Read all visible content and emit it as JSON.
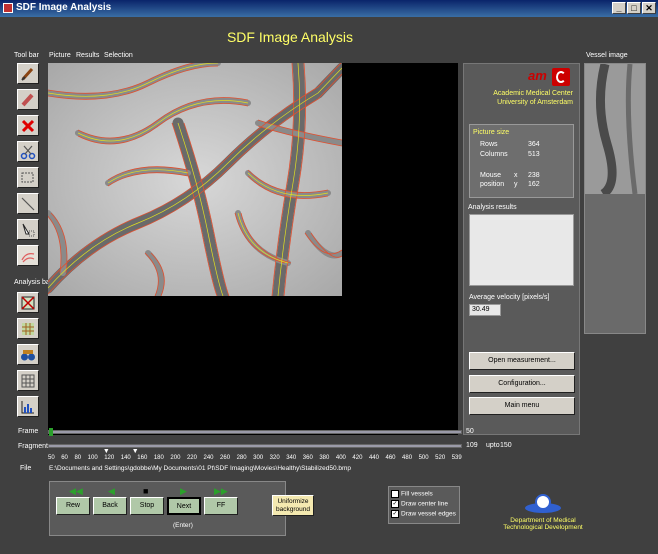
{
  "window": {
    "title": "SDF Image Analysis",
    "minimize": "_",
    "maximize": "□",
    "close": "✕"
  },
  "app_title": "SDF Image Analysis",
  "menu": {
    "toolbar": "Tool bar",
    "picture": "Picture",
    "results": "Results",
    "selection": "Selection"
  },
  "analysis_bar_label": "Analysis bar",
  "tools": [
    "brush-icon",
    "eraser-icon",
    "delete-icon",
    "scissors-icon",
    "select-rect-icon",
    "line-icon",
    "fill-select-icon",
    "vessel-draw-icon"
  ],
  "analysis_tools": [
    "crosshair-icon",
    "mesh-icon",
    "binoculars-icon",
    "grid-icon",
    "histogram-icon"
  ],
  "logo": {
    "mark": "am",
    "line1": "Academic Medical Center",
    "line2": "University of Amsterdam"
  },
  "picture_size": {
    "heading": "Picture size",
    "rows_label": "Rows",
    "rows": "364",
    "columns_label": "Columns",
    "columns": "513",
    "mouse_label1": "Mouse",
    "mouse_label2": "position",
    "x_label": "x",
    "x": "238",
    "y_label": "y",
    "y": "162"
  },
  "analysis_results_label": "Analysis results",
  "velocity": {
    "label": "Average velocity [pixels/s]",
    "value": "30.49"
  },
  "buttons": {
    "open": "Open measurement...",
    "config": "Configuration...",
    "main": "Main menu"
  },
  "vessel_image_label": "Vessel image",
  "frame": {
    "label": "Frame",
    "value": "50",
    "position": 0.0
  },
  "fragment": {
    "label": "Fragment",
    "value": "109",
    "upto_label": "upto",
    "upto": "150",
    "start": 0.13,
    "end": 0.2
  },
  "ticks": [
    "50",
    "60",
    "80",
    "100",
    "120",
    "140",
    "160",
    "180",
    "200",
    "220",
    "240",
    "260",
    "280",
    "300",
    "320",
    "340",
    "360",
    "380",
    "400",
    "420",
    "440",
    "460",
    "480",
    "500",
    "520",
    "539"
  ],
  "file": {
    "label": "File",
    "path": "E:\\Documents and Settings\\gdobbe\\My Documents\\01 Pt\\SDF Imaging\\Movies\\Healthy\\Stabilized50.bmp"
  },
  "controls": {
    "rew": "Rew",
    "back": "Back",
    "stop": "Stop",
    "next": "Next",
    "ff": "FF",
    "enter": "(Enter)",
    "uniformize1": "Uniformize",
    "uniformize2": "background"
  },
  "checks": {
    "fill": "Fill vessels",
    "center": "Draw center line",
    "edges": "Draw vessel edges",
    "fill_checked": false,
    "center_checked": true,
    "edges_checked": true
  },
  "dept": {
    "line1": "Department of Medical",
    "line2": "Technological Development"
  },
  "colors": {
    "title_yellow": "#ffff66",
    "logo_red": "#cc0000",
    "vessel_edge": "#e05030",
    "center_line": "#e0e020",
    "nav_green": "#2ba02b"
  }
}
